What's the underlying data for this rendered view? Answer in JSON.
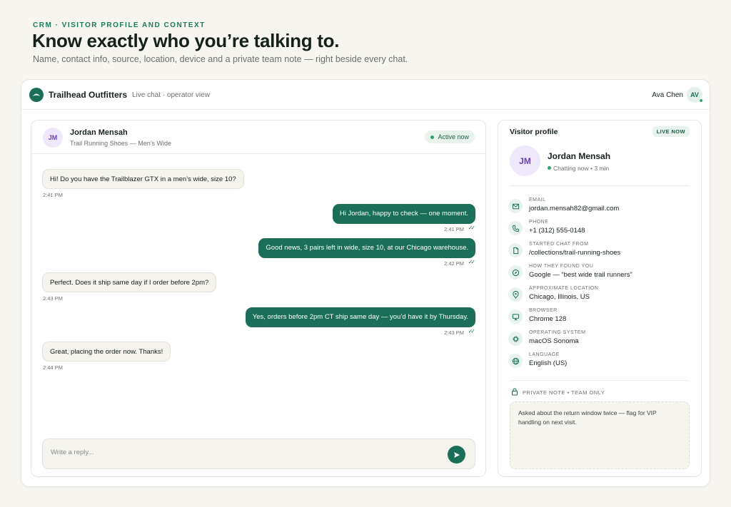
{
  "page": {
    "eyebrow": "CRM · VISITOR PROFILE AND CONTEXT",
    "headline": "Know exactly who you’re talking to.",
    "subline": "Name, contact info, source, location, device and a private team note — right beside every chat."
  },
  "app": {
    "brand": "Trailhead Outfitters",
    "mode": "Live chat · operator view",
    "operator_name": "Ava Chen",
    "operator_initials": "AV"
  },
  "chat": {
    "visitor_initials": "JM",
    "visitor_name": "Jordan Mensah",
    "visitor_context": "Trail Running Shoes — Men’s Wide",
    "status": "Active now",
    "messages": [
      {
        "dir": "in",
        "text": "Hi! Do you have the Trailblazer GTX in a men’s wide, size 10?",
        "time": "2:41 PM"
      },
      {
        "dir": "out",
        "text": "Hi Jordan, happy to check — one moment.",
        "time": "2:41 PM"
      },
      {
        "dir": "out",
        "text": "Good news, 3 pairs left in wide, size 10, at our Chicago warehouse.",
        "time": "2:42 PM"
      },
      {
        "dir": "in",
        "text": "Perfect. Does it ship same day if I order before 2pm?",
        "time": "2:43 PM"
      },
      {
        "dir": "out",
        "text": "Yes, orders before 2pm CT ship same day — you’d have it by Thursday.",
        "time": "2:43 PM"
      },
      {
        "dir": "in",
        "text": "Great, placing the order now. Thanks!",
        "time": "2:44 PM"
      }
    ],
    "reply_placeholder": "Write a reply..."
  },
  "profile": {
    "title": "Visitor profile",
    "badge": "LIVE NOW",
    "initials": "JM",
    "name": "Jordan Mensah",
    "status": "Chatting now • 3 min",
    "fields": [
      {
        "icon": "mail-icon",
        "label": "EMAIL",
        "value": "jordan.mensah82@gmail.com"
      },
      {
        "icon": "phone-icon",
        "label": "PHONE",
        "value": "+1 (312) 555-0148"
      },
      {
        "icon": "document-icon",
        "label": "STARTED CHAT FROM",
        "value": "/collections/trail-running-shoes"
      },
      {
        "icon": "compass-icon",
        "label": "HOW THEY FOUND YOU",
        "value": "Google — “best wide trail runners”"
      },
      {
        "icon": "location-pin-icon",
        "label": "APPROXIMATE LOCATION",
        "value": "Chicago, Illinois, US"
      },
      {
        "icon": "monitor-icon",
        "label": "BROWSER",
        "value": "Chrome 128"
      },
      {
        "icon": "cpu-icon",
        "label": "OPERATING SYSTEM",
        "value": "macOS Sonoma"
      },
      {
        "icon": "globe-icon",
        "label": "LANGUAGE",
        "value": "English (US)"
      }
    ],
    "note_label": "PRIVATE NOTE • TEAM ONLY",
    "note_text": "Asked about the return window twice — flag for VIP handling on next visit."
  },
  "colors": {
    "accent": "#1b6f58",
    "online": "#2fa36b",
    "avatar_bg": "#efe8fb",
    "avatar_fg": "#6a3fb5",
    "background": "#f6f5f0"
  }
}
